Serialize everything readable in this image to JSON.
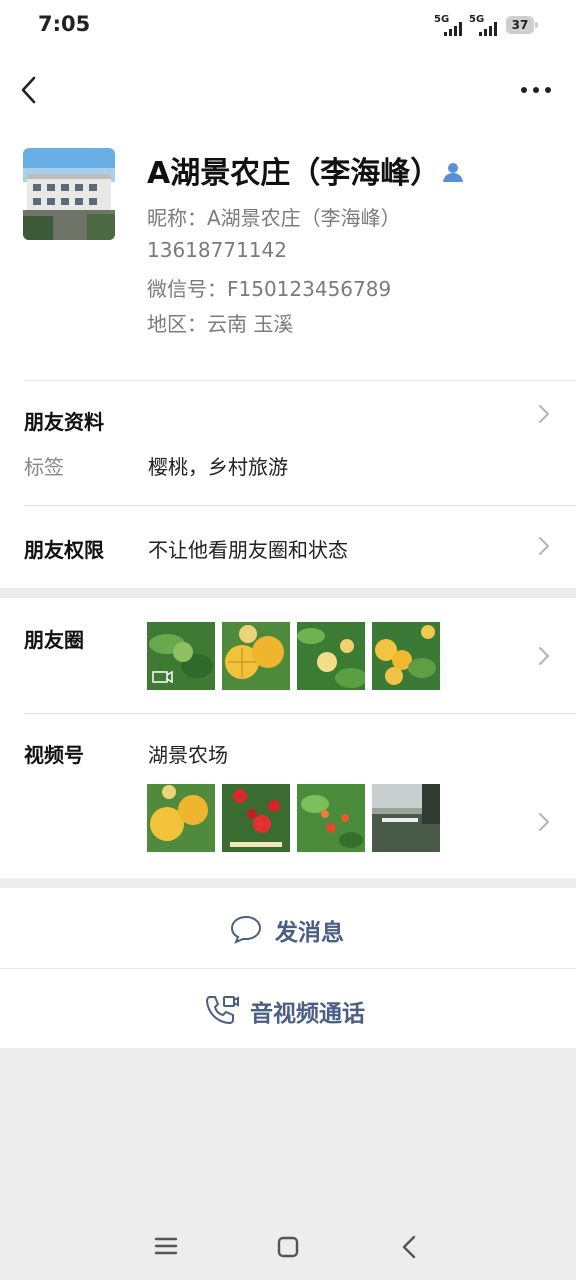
{
  "status_bar": {
    "time": "7:05",
    "signal1": "5G",
    "signal2": "5G",
    "battery": "37"
  },
  "colors": {
    "accent_blue": "#4a5e86",
    "avatar_badge": "#5a8ed8",
    "bg_gray": "#ededed"
  },
  "profile": {
    "name": "A湖景农庄（李海峰）",
    "nickname": "昵称：A湖景农庄（李海峰）",
    "phone": "13618771142",
    "wechat_id": "微信号：F150123456789",
    "region": "地区：云南  玉溪"
  },
  "info": {
    "friend_profile_label": "朋友资料",
    "tag_label": "标签",
    "tag_value": "樱桃，乡村旅游",
    "permission_label": "朋友权限",
    "permission_value": "不让他看朋友圈和状态"
  },
  "moments": {
    "label": "朋友圈"
  },
  "channels": {
    "label": "视频号",
    "name": "湖景农场"
  },
  "actions": {
    "message": "发消息",
    "call": "音视频通话"
  },
  "icons": [
    "back-icon",
    "more-icon",
    "contact-badge-icon",
    "chevron-right-icon",
    "chat-bubble-icon",
    "video-call-icon",
    "menu-nav-icon",
    "home-nav-icon",
    "back-nav-icon"
  ]
}
